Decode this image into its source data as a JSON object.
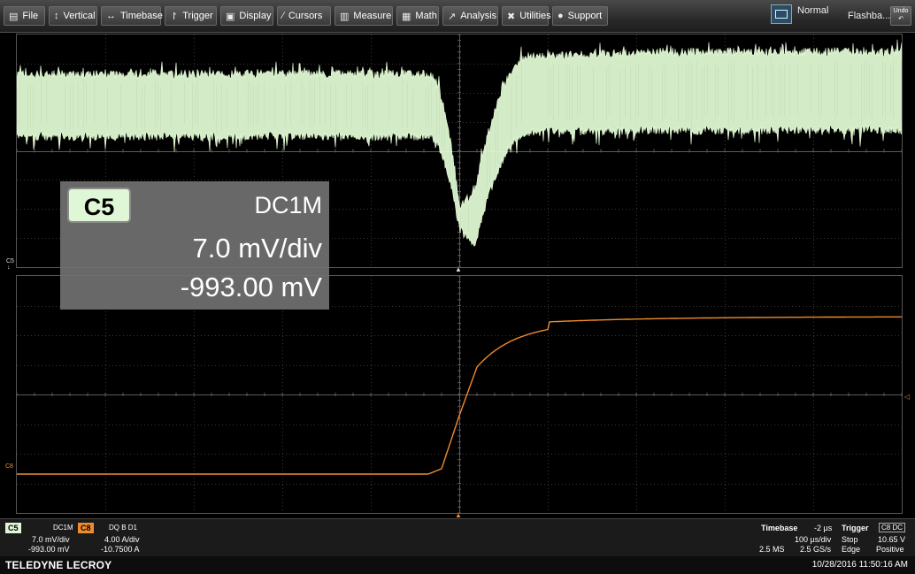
{
  "menu": [
    {
      "label": "File",
      "icon": "file-icon",
      "glyph": "▤"
    },
    {
      "label": "Vertical",
      "icon": "vertical-arrows-icon",
      "glyph": "↕"
    },
    {
      "label": "Timebase",
      "icon": "horizontal-arrows-icon",
      "glyph": "↔"
    },
    {
      "label": "Trigger",
      "icon": "trigger-icon",
      "glyph": "↾"
    },
    {
      "label": "Display",
      "icon": "display-icon",
      "glyph": "▣"
    },
    {
      "label": "Cursors",
      "icon": "cursors-icon",
      "glyph": "∕"
    },
    {
      "label": "Measure",
      "icon": "measure-icon",
      "glyph": "▥"
    },
    {
      "label": "Math",
      "icon": "math-icon",
      "glyph": "▦"
    },
    {
      "label": "Analysis",
      "icon": "analysis-icon",
      "glyph": "↗"
    },
    {
      "label": "Utilities",
      "icon": "utilities-icon",
      "glyph": "✖"
    },
    {
      "label": "Support",
      "icon": "support-icon",
      "glyph": "●"
    }
  ],
  "mode": "Normal",
  "flashback": "Flashba...",
  "undo": "Undo",
  "badge": {
    "channel": "C5",
    "coupling": "DC1M",
    "scale": "7.0 mV/div",
    "offset": "-993.00 mV"
  },
  "markers": {
    "c5": "C5",
    "c8": "C8"
  },
  "channels": [
    {
      "name": "C5",
      "coupling": "DC1M",
      "scale": "7.0 mV/div",
      "offset": "-993.00 mV",
      "color": "#dff7d6"
    },
    {
      "name": "C8",
      "coupling": "DQ B D1",
      "scale": "4.00 A/div",
      "offset": "-10.7500 A",
      "color": "#ff8c2e"
    }
  ],
  "timebase": {
    "title": "Timebase",
    "delay": "-2 µs",
    "per_div": "100 µs/div",
    "samples": "2.5 MS",
    "rate": "2.5 GS/s"
  },
  "trigger": {
    "title": "Trigger",
    "source": "C8 DC",
    "mode": "Stop",
    "level": "10.65 V",
    "type": "Edge",
    "slope": "Positive"
  },
  "brand": "TELEDYNE LECROY",
  "datetime": "10/28/2016 11:50:16 AM",
  "colors": {
    "c5_trace": "#e6ffd8",
    "c8_trace": "#f08a2c",
    "grid": "#3c3c3c"
  }
}
